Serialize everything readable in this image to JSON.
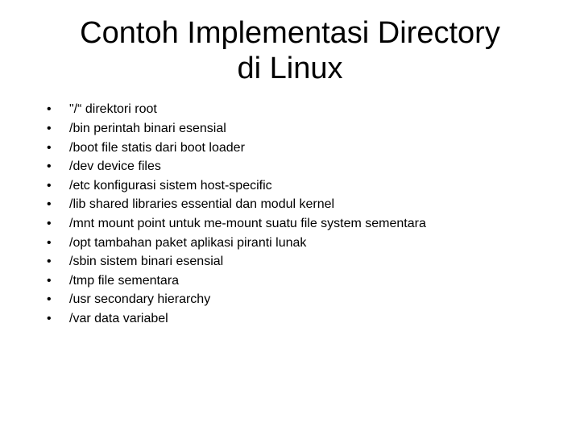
{
  "title": "Contoh Implementasi Directory di Linux",
  "bullets": [
    "\"/“ direktori root",
    "/bin perintah binari esensial",
    "/boot file statis dari boot loader",
    "/dev device files",
    "/etc konfigurasi sistem host-specific",
    "/lib  shared libraries essential dan modul kernel",
    "/mnt mount point untuk me-mount suatu file system sementara",
    "/opt tambahan paket aplikasi piranti lunak",
    "/sbin sistem binari esensial",
    "/tmp file sementara",
    "/usr secondary hierarchy",
    "/var data variabel"
  ]
}
